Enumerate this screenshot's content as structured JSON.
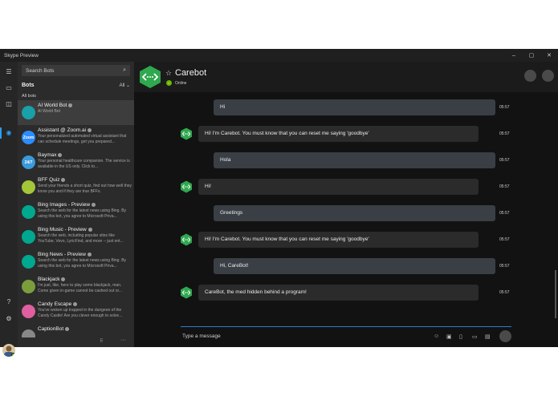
{
  "window": {
    "title": "Skype Preview",
    "controls": [
      "–",
      "▢",
      "✕"
    ]
  },
  "sidebar": {
    "search_placeholder": "Search Bots",
    "section_title": "Bots",
    "filter_label": "All",
    "subsection": "All bots",
    "items": [
      {
        "name": "AI World Bot",
        "desc": "AI World Bot",
        "color": "#19a0a8",
        "glyph": "",
        "selected": true
      },
      {
        "name": "Assistant @ Zoom.ai",
        "desc": "Your personalized automated virtual assistant that can schedule meetings, get you prepared...",
        "color": "#2d8cff",
        "glyph": "Zoom"
      },
      {
        "name": "Baymax",
        "desc": "Your personal healthcare companion. The service is available in the US only. Click to...",
        "color": "#3a9ad9",
        "glyph": "24/7"
      },
      {
        "name": "BFF Quiz",
        "desc": "Send your friends a short quiz, find out how well they know you and if they are true BFFs.",
        "color": "#a4c639",
        "glyph": ""
      },
      {
        "name": "Bing Images - Preview",
        "desc": "Search the web for the latest news using Bing. By using this bot, you agree to Microsoft Priva...",
        "color": "#00a88f",
        "glyph": ""
      },
      {
        "name": "Bing Music - Preview",
        "desc": "Search the web, including popular sites like YouTube, Vevo, LyricFind, and more -- just ent...",
        "color": "#00a88f",
        "glyph": ""
      },
      {
        "name": "Bing News - Preview",
        "desc": "Search the web for the latest news using Bing. By using this bot, you agree to Microsoft Priva...",
        "color": "#00a88f",
        "glyph": ""
      },
      {
        "name": "Blackjack",
        "desc": "I'm just, like, here to play some blackjack, man. Come given in-game cannot be cashed out or...",
        "color": "#7a9e3b",
        "glyph": ""
      },
      {
        "name": "Candy Escape",
        "desc": "You've woken up trapped in the dungeon of the Candy Castle! Are you clever enough to solve...",
        "color": "#e05fa0",
        "glyph": ""
      },
      {
        "name": "CaptionBot",
        "desc": "",
        "color": "#888888",
        "glyph": ""
      }
    ],
    "footer_icons": [
      "⠿",
      "···"
    ]
  },
  "chat": {
    "title": "Carebot",
    "star": "☆",
    "status": "Online",
    "accent": "#2fa84f",
    "messages": [
      {
        "dir": "out",
        "text": "Hi",
        "time": "05:57"
      },
      {
        "dir": "in",
        "text": "Hi! I'm Carebot. You must know that you can reset me saying 'goodbye'",
        "time": "05:57"
      },
      {
        "dir": "out",
        "text": "Hola",
        "time": "05:57"
      },
      {
        "dir": "in",
        "text": "Hi!",
        "time": "05:57"
      },
      {
        "dir": "out",
        "text": "Greetings",
        "time": "05:57"
      },
      {
        "dir": "in",
        "text": "Hi! I'm Carebot. You must know that you can reset me saying 'goodbye'",
        "time": "05:57"
      },
      {
        "dir": "out",
        "text": "Hi, CareBot!",
        "time": "05:57"
      },
      {
        "dir": "in",
        "text": "CareBot, the med hidden behind a program!",
        "time": "05:57"
      }
    ],
    "compose_placeholder": "Type a message"
  }
}
